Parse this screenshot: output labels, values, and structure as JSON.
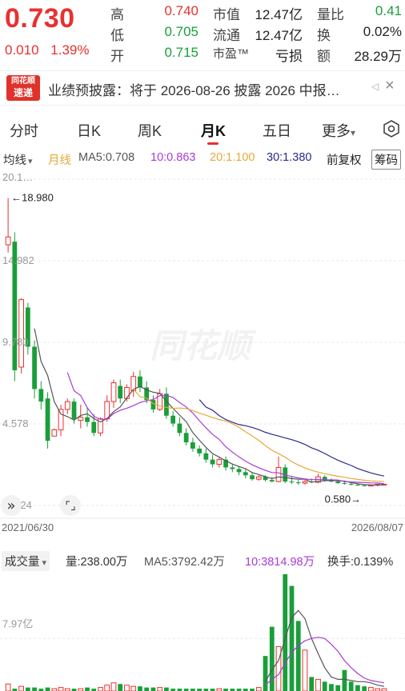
{
  "quote": {
    "price": "0.730",
    "change": "0.010",
    "change_pct": "1.39%",
    "high_label": "高",
    "high": "0.740",
    "low_label": "低",
    "low": "0.705",
    "open_label": "开",
    "open": "0.715",
    "mktcap_label": "市值",
    "mktcap": "12.47亿",
    "float_label": "流通",
    "float": "12.47亿",
    "pe_label": "市盈™",
    "pe": "亏损",
    "volratio_label": "量比",
    "volratio": "0.41",
    "turnover_label": "换",
    "turnover": "0.02%",
    "amount_label": "额",
    "amount": "28.29万"
  },
  "notice": {
    "logo_line1": "同花顺",
    "logo_line2": "速递",
    "text": "业绩预披露：将于 2026-08-26 披露 2026 中报…",
    "ad": "◁",
    "close": "×"
  },
  "tabs": {
    "items": [
      "分时",
      "日K",
      "周K",
      "月K",
      "五日",
      "更多"
    ],
    "active": "月K",
    "more_arrow": "▾"
  },
  "ma_legend": {
    "avg_select": "均线",
    "avg_arrow": "▾",
    "period": "月线",
    "ma5": "MA5:0.708",
    "ma10": "10:0.863",
    "ma20": "20:1.100",
    "ma30": "30:1.380",
    "adjust": "前复权",
    "chips": "筹码"
  },
  "colors": {
    "up": "#e93030",
    "down": "#1a9e3a",
    "ma5": "#555555",
    "ma10": "#a83adb",
    "ma20": "#e8a93a",
    "ma30": "#2a2a8c"
  },
  "chart": {
    "y_labels": [
      "20.1…",
      "14.982",
      "9.780",
      "4.578",
      "-0.624"
    ],
    "max_label": "18.980",
    "min_label": "0.580→",
    "date_start": "2021/06/30",
    "date_end": "2026/08/07",
    "watermark": "同花顺",
    "expand_icon": "»",
    "fullscreen_icon": "⌜⌟"
  },
  "volume": {
    "select": "成交量",
    "select_arrow": "▾",
    "vol": "量:238.00万",
    "ma5": "MA5:3792.42万",
    "ma10": "10:3814.98万",
    "turnover": "换手:0.139%",
    "y_label": "7.97亿"
  },
  "chart_data": {
    "type": "candlestick",
    "y_range": [
      -0.624,
      20.184
    ],
    "candles": [
      [
        16.0,
        18.98,
        15.5,
        16.5
      ],
      [
        16.2,
        16.8,
        7.3,
        8.0
      ],
      [
        8.2,
        12.6,
        7.8,
        12.5
      ],
      [
        12.0,
        12.3,
        9.0,
        9.5
      ],
      [
        9.5,
        9.9,
        6.2,
        6.8
      ],
      [
        6.8,
        7.3,
        5.5,
        6.0
      ],
      [
        6.2,
        6.6,
        3.0,
        3.5
      ],
      [
        3.8,
        4.3,
        3.8,
        4.2
      ],
      [
        4.2,
        5.8,
        3.8,
        5.5
      ],
      [
        5.5,
        6.2,
        5.2,
        6.0
      ],
      [
        6.0,
        6.2,
        4.6,
        4.9
      ],
      [
        4.8,
        5.8,
        4.3,
        5.0
      ],
      [
        5.0,
        5.6,
        4.4,
        4.7
      ],
      [
        4.7,
        5.2,
        3.8,
        4.0
      ],
      [
        4.0,
        5.0,
        3.8,
        4.9
      ],
      [
        4.9,
        6.4,
        4.7,
        6.0
      ],
      [
        6.0,
        7.4,
        5.6,
        7.2
      ],
      [
        7.0,
        7.4,
        5.9,
        6.2
      ],
      [
        6.2,
        7.1,
        6.0,
        6.9
      ],
      [
        6.7,
        7.9,
        6.3,
        7.6
      ],
      [
        7.6,
        8.0,
        6.6,
        6.9
      ],
      [
        6.9,
        7.3,
        5.9,
        6.1
      ],
      [
        6.1,
        6.4,
        5.3,
        5.5
      ],
      [
        5.5,
        6.8,
        5.4,
        6.5
      ],
      [
        6.5,
        6.9,
        4.9,
        5.1
      ],
      [
        5.1,
        5.4,
        4.4,
        4.6
      ],
      [
        4.6,
        5.0,
        3.8,
        4.0
      ],
      [
        4.0,
        4.3,
        3.2,
        3.4
      ],
      [
        3.4,
        3.7,
        2.8,
        3.0
      ],
      [
        3.0,
        3.2,
        2.5,
        2.7
      ],
      [
        2.7,
        3.0,
        2.1,
        2.3
      ],
      [
        2.3,
        2.6,
        1.8,
        2.0
      ],
      [
        2.0,
        2.5,
        1.8,
        2.3
      ],
      [
        2.3,
        2.5,
        1.6,
        1.8
      ],
      [
        1.8,
        2.0,
        1.5,
        1.7
      ],
      [
        1.7,
        1.9,
        1.3,
        1.5
      ],
      [
        1.5,
        1.7,
        1.1,
        1.3
      ],
      [
        1.3,
        1.5,
        0.95,
        1.05
      ],
      [
        1.05,
        1.3,
        0.95,
        1.2
      ],
      [
        1.2,
        1.3,
        0.9,
        1.0
      ],
      [
        1.0,
        1.2,
        0.85,
        0.9
      ],
      [
        0.9,
        2.5,
        0.85,
        1.8
      ],
      [
        1.8,
        2.0,
        0.8,
        0.9
      ],
      [
        0.9,
        1.2,
        0.75,
        0.85
      ],
      [
        0.85,
        1.0,
        0.7,
        0.8
      ],
      [
        0.8,
        1.0,
        0.7,
        0.9
      ],
      [
        0.9,
        1.1,
        0.8,
        0.85
      ],
      [
        0.85,
        1.4,
        0.8,
        1.2
      ],
      [
        1.2,
        1.3,
        0.9,
        1.0
      ],
      [
        1.0,
        1.1,
        0.85,
        0.9
      ],
      [
        0.9,
        1.0,
        0.75,
        0.8
      ],
      [
        0.8,
        0.9,
        0.7,
        0.75
      ],
      [
        0.75,
        0.85,
        0.65,
        0.7
      ],
      [
        0.7,
        0.8,
        0.62,
        0.66
      ],
      [
        0.66,
        0.72,
        0.58,
        0.62
      ],
      [
        0.62,
        0.7,
        0.58,
        0.68
      ],
      [
        0.68,
        0.74,
        0.6,
        0.72
      ],
      [
        0.715,
        0.74,
        0.705,
        0.73
      ]
    ],
    "volume_visible": [
      0.06,
      0.02,
      0.04,
      0.03,
      0.03,
      0.02,
      0.03,
      0.02,
      0.03,
      0.02,
      0.02,
      0.02,
      0.03,
      0.02,
      0.03,
      0.05,
      0.07,
      0.06,
      0.05,
      0.04,
      0.04,
      0.03,
      0.03,
      0.03,
      0.03,
      0.02,
      0.02,
      0.02,
      0.02,
      0.02,
      0.02,
      0.02,
      0.02,
      0.02,
      0.02,
      0.02,
      0.02,
      0.02,
      0.03,
      0.3,
      0.55,
      0.38,
      1.0,
      0.9,
      0.6,
      0.35,
      0.12,
      0.1,
      0.08,
      0.06,
      0.05,
      0.18,
      0.08,
      0.05,
      0.04,
      0.03,
      0.02,
      0.02
    ],
    "volume_ma5": [
      null,
      null,
      null,
      null,
      null,
      null,
      null,
      null,
      null,
      null,
      null,
      null,
      null,
      null,
      null,
      null,
      null,
      null,
      null,
      null,
      null,
      null,
      null,
      null,
      null,
      null,
      null,
      null,
      null,
      null,
      null,
      null,
      null,
      null,
      null,
      null,
      null,
      null,
      null,
      0.08,
      0.18,
      0.26,
      0.45,
      0.63,
      0.69,
      0.62,
      0.45,
      0.32,
      0.2,
      0.12,
      0.1,
      0.1,
      0.09,
      0.08,
      0.08,
      0.07,
      0.05,
      0.04
    ],
    "volume_ma10": [
      null,
      null,
      null,
      null,
      null,
      null,
      null,
      null,
      null,
      null,
      null,
      null,
      null,
      null,
      null,
      null,
      null,
      null,
      null,
      null,
      null,
      null,
      null,
      null,
      null,
      null,
      null,
      null,
      null,
      null,
      null,
      null,
      null,
      null,
      null,
      null,
      null,
      null,
      null,
      0.05,
      0.1,
      0.14,
      0.24,
      0.33,
      0.39,
      0.43,
      0.45,
      0.46,
      0.45,
      0.4,
      0.34,
      0.26,
      0.2,
      0.15,
      0.11,
      0.09,
      0.08,
      0.07
    ]
  }
}
